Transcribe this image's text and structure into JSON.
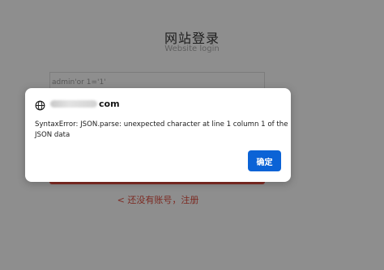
{
  "page": {
    "title": "网站登录",
    "subtitle": "Website login",
    "username_value": "admin'or  1='1'",
    "register_link": "< 还没有账号，注册"
  },
  "dialog": {
    "origin_suffix": "com",
    "message": "SyntaxError: JSON.parse: unexpected character at line 1 column 1 of the JSON data",
    "ok_label": "确定",
    "icon": "globe-icon"
  },
  "colors": {
    "overlay_background": "#8e8e8e",
    "primary_button": "#0b63d6",
    "login_button": "#852d25",
    "register_link": "#7c2a22"
  }
}
